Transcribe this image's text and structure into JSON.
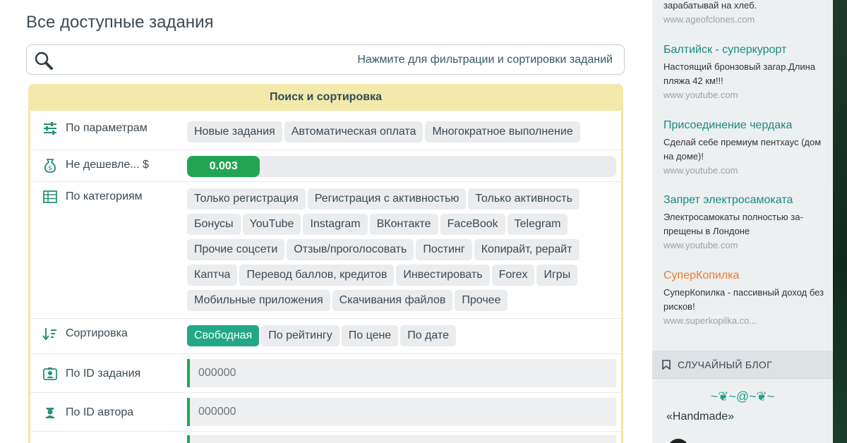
{
  "page_title": "Все доступные задания",
  "search": {
    "text": "Нажмите для фильтрации и сортировки заданий"
  },
  "panel": {
    "title": "Поиск и сортировка",
    "params": {
      "label": "По параметрам",
      "chips": [
        "Новые задания",
        "Автоматическая оплата",
        "Многократное выполнение"
      ]
    },
    "price": {
      "label": "Не дешевле... $",
      "value": "0.003",
      "fill_fraction": 0.17
    },
    "categories": {
      "label": "По категориям",
      "chips": [
        "Только регистрация",
        "Регистрация с активностью",
        "Только активность",
        "Бонусы",
        "YouTube",
        "Instagram",
        "ВКонтакте",
        "FaceBook",
        "Telegram",
        "Прочие соцсети",
        "Отзыв/проголосовать",
        "Постинг",
        "Копирайт, рерайт",
        "Каптча",
        "Перевод баллов, кредитов",
        "Инвестировать",
        "Forex",
        "Игры",
        "Мобильные приложения",
        "Скачивания файлов",
        "Прочее"
      ]
    },
    "sort": {
      "label": "Сортировка",
      "chips": [
        "Свободная",
        "По рейтингу",
        "По цене",
        "По дате"
      ],
      "active_index": 0
    },
    "task_id": {
      "label": "По ID задания",
      "placeholder": "000000"
    },
    "author_id": {
      "label": "По ID автора",
      "placeholder": "000000"
    }
  },
  "sidebar": {
    "ads": [
      {
        "title": "",
        "desc": "зарабатывай на хлеб.",
        "url": "www.ageofclones.com"
      },
      {
        "title": "Балтийск - суперкурорт",
        "desc": "Настоящий бронзовый загар.Длина пляжа 42 км!!!",
        "url": "www.youtube.com"
      },
      {
        "title": "Присоединение чердака",
        "desc": "Сделай себе премиум пентхаус (дом на доме)!",
        "url": "www.youtube.com"
      },
      {
        "title": "Запрет электросамоката",
        "desc": "Электросамокаты полностью за-прещены в Лондоне",
        "url": "www.youtube.com"
      },
      {
        "title": "СуперКопилка",
        "desc": "СуперКопилка - пассивный доход без рисков!",
        "url": "www.superkopilka.co..."
      }
    ],
    "blog": {
      "heading": "СЛУЧАЙНЫЙ БЛОГ",
      "ornament": "~❦~@~❦~",
      "name": "«Handmade»"
    }
  },
  "colors": {
    "accent_green": "#21a553",
    "teal": "#22a887",
    "panel_yellow": "#f3e9ab",
    "link_teal": "#1a8a80",
    "orange": "#ef7a2b"
  }
}
